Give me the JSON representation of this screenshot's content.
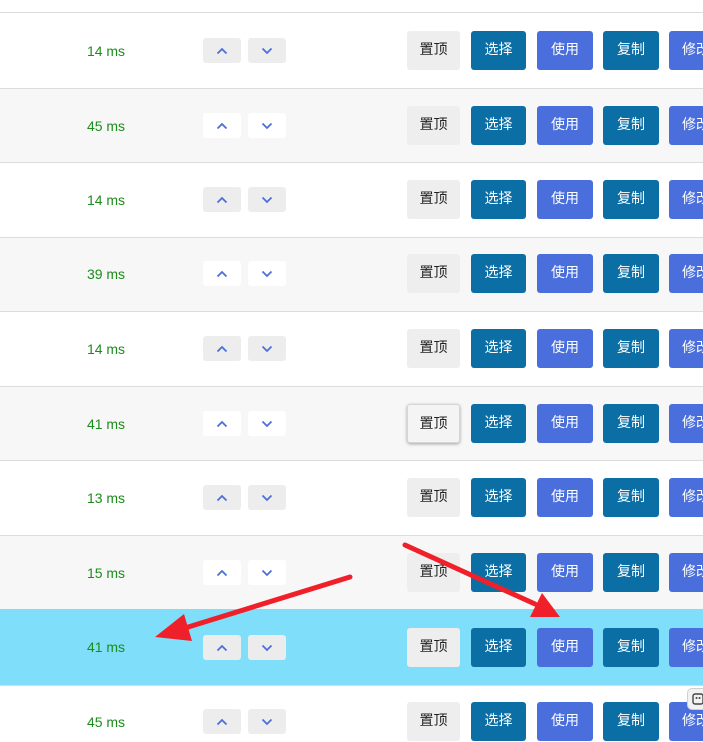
{
  "rows": [
    {
      "latency": "14 ms",
      "pin_label": "置顶",
      "select_label": "选择",
      "use_label": "使用",
      "copy_label": "复制",
      "edit_label": "修改"
    },
    {
      "latency": "45 ms",
      "pin_label": "置顶",
      "select_label": "选择",
      "use_label": "使用",
      "copy_label": "复制",
      "edit_label": "修改"
    },
    {
      "latency": "14 ms",
      "pin_label": "置顶",
      "select_label": "选择",
      "use_label": "使用",
      "copy_label": "复制",
      "edit_label": "修改"
    },
    {
      "latency": "39 ms",
      "pin_label": "置顶",
      "select_label": "选择",
      "use_label": "使用",
      "copy_label": "复制",
      "edit_label": "修改"
    },
    {
      "latency": "14 ms",
      "pin_label": "置顶",
      "select_label": "选择",
      "use_label": "使用",
      "copy_label": "复制",
      "edit_label": "修改"
    },
    {
      "latency": "41 ms",
      "pin_label": "置顶",
      "select_label": "选择",
      "use_label": "使用",
      "copy_label": "复制",
      "edit_label": "修改"
    },
    {
      "latency": "13 ms",
      "pin_label": "置顶",
      "select_label": "选择",
      "use_label": "使用",
      "copy_label": "复制",
      "edit_label": "修改"
    },
    {
      "latency": "15 ms",
      "pin_label": "置顶",
      "select_label": "选择",
      "use_label": "使用",
      "copy_label": "复制",
      "edit_label": "修改"
    },
    {
      "latency": "41 ms",
      "pin_label": "置顶",
      "select_label": "选择",
      "use_label": "使用",
      "copy_label": "复制",
      "edit_label": "修改"
    },
    {
      "latency": "45 ms",
      "pin_label": "置顶",
      "select_label": "选择",
      "use_label": "使用",
      "copy_label": "复制",
      "edit_label": "修改"
    }
  ],
  "icons": {
    "move_up": "chevron-up-icon",
    "move_down": "chevron-down-icon",
    "annotation": "red-arrow-icon"
  },
  "colors": {
    "latency_text": "#1c8c1c",
    "select_button": "#0b6fa6",
    "use_button": "#4a6fdc",
    "copy_button": "#0b6fa6",
    "edit_button": "#4a6fdc",
    "highlight_row": "#7fdffa",
    "annotation_arrow": "#f0202a"
  }
}
